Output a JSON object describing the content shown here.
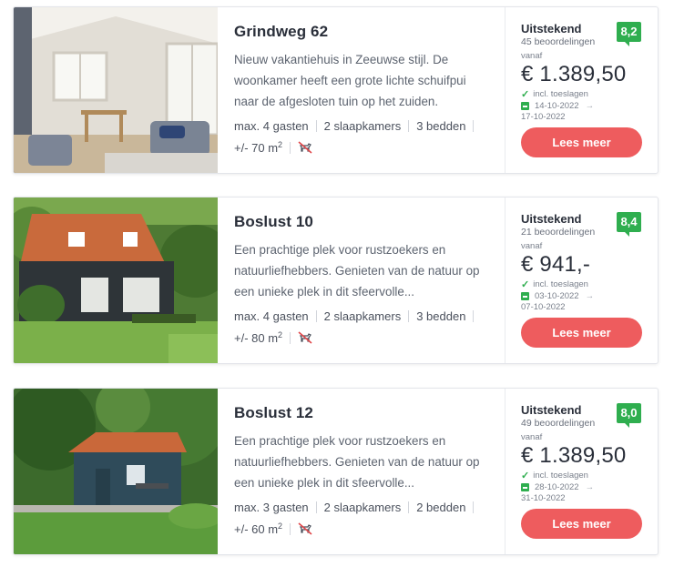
{
  "listings": [
    {
      "title": "Grindweg 62",
      "description": "Nieuw vakantiehuis in Zeeuwse stijl. De woonkamer heeft een grote lichte schuifpui naar de afgesloten tuin op het zuiden.",
      "guests": "max. 4 gasten",
      "bedrooms": "2 slaapkamers",
      "beds": "3 bedden",
      "area": "+/- 70 m",
      "area_sup": "2",
      "rating_label": "Uitstekend",
      "reviews": "45 beoordelingen",
      "score": "8,2",
      "from_label": "vanaf",
      "price": "€ 1.389,50",
      "incl": "incl. toeslagen",
      "date_from": "14-10-2022",
      "date_to": "17-10-2022",
      "button": "Lees meer"
    },
    {
      "title": "Boslust 10",
      "description": "Een prachtige plek voor rustzoekers en natuurliefhebbers. Genieten van de natuur op een unieke plek in dit sfeervolle...",
      "guests": "max. 4 gasten",
      "bedrooms": "2 slaapkamers",
      "beds": "3 bedden",
      "area": "+/- 80 m",
      "area_sup": "2",
      "rating_label": "Uitstekend",
      "reviews": "21 beoordelingen",
      "score": "8,4",
      "from_label": "vanaf",
      "price": "€ 941,-",
      "incl": "incl. toeslagen",
      "date_from": "03-10-2022",
      "date_to": "07-10-2022",
      "button": "Lees meer"
    },
    {
      "title": "Boslust 12",
      "description": "Een prachtige plek voor rustzoekers en natuurliefhebbers. Genieten van de natuur op een unieke plek in dit sfeervolle...",
      "guests": "max. 3 gasten",
      "bedrooms": "2 slaapkamers",
      "beds": "2 bedden",
      "area": "+/- 60 m",
      "area_sup": "2",
      "rating_label": "Uitstekend",
      "reviews": "49 beoordelingen",
      "score": "8,0",
      "from_label": "vanaf",
      "price": "€ 1.389,50",
      "incl": "incl. toeslagen",
      "date_from": "28-10-2022",
      "date_to": "31-10-2022",
      "button": "Lees meer"
    }
  ],
  "colors": {
    "score_badge": "#2fae4f",
    "button": "#ee5c5e",
    "check": "#2fae4f"
  },
  "icons": [
    "check-icon",
    "calendar-icon",
    "arrow-right-icon",
    "no-pets-icon"
  ]
}
